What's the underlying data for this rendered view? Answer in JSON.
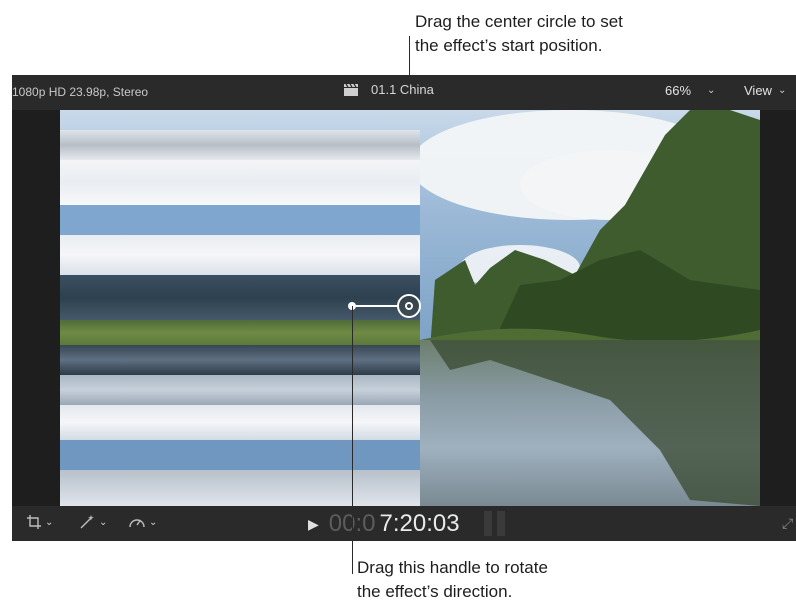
{
  "callouts": {
    "top_line1": "Drag the center circle to set",
    "top_line2": "the effect’s start position.",
    "bottom_line1": "Drag this handle to rotate",
    "bottom_line2": "the effect’s direction."
  },
  "viewer": {
    "format": "1080p HD 23.98p, Stereo",
    "clip_name": "01.1 China",
    "zoom": "66%",
    "view_label": "View"
  },
  "playback": {
    "timecode_dim": "00:0",
    "timecode_bright": "7:20:03"
  },
  "icons": {
    "clapper": "clapperboard-icon",
    "crop": "crop-icon",
    "enhance": "magic-wand-icon",
    "retime": "speedometer-icon",
    "play": "play-icon",
    "fullscreen": "fullscreen-icon"
  },
  "colors": {
    "bar_bg": "#2a2a2a",
    "viewer_bg": "#1e1e1e",
    "onscreen_control": "#ffffff"
  }
}
